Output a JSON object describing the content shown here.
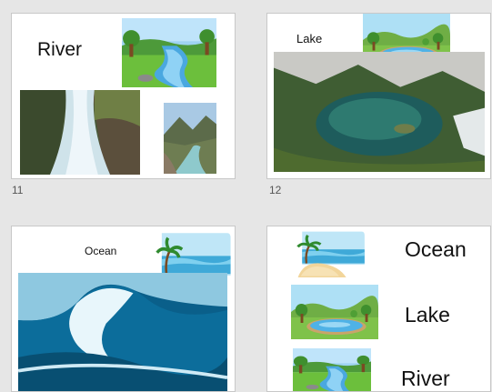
{
  "slides": [
    {
      "number": "11",
      "title": "River",
      "images": [
        "cartoon-river-picture",
        "waterfall-river-photo",
        "mountain-river-photo"
      ]
    },
    {
      "number": "12",
      "title": "Lake",
      "images": [
        "cartoon-lake-picture",
        "mountain-lake-photo"
      ]
    },
    {
      "number": "",
      "title": "Ocean",
      "images": [
        "cartoon-beach-picture",
        "ocean-wave-photo"
      ]
    },
    {
      "number": "",
      "labels": [
        "Ocean",
        "Lake",
        "River"
      ],
      "images": [
        "cartoon-beach-picture",
        "cartoon-lake-picture",
        "cartoon-river-picture"
      ]
    }
  ],
  "colors": {
    "background": "#e6e6e6",
    "slide": "#ffffff",
    "border": "#c8c8c8"
  }
}
